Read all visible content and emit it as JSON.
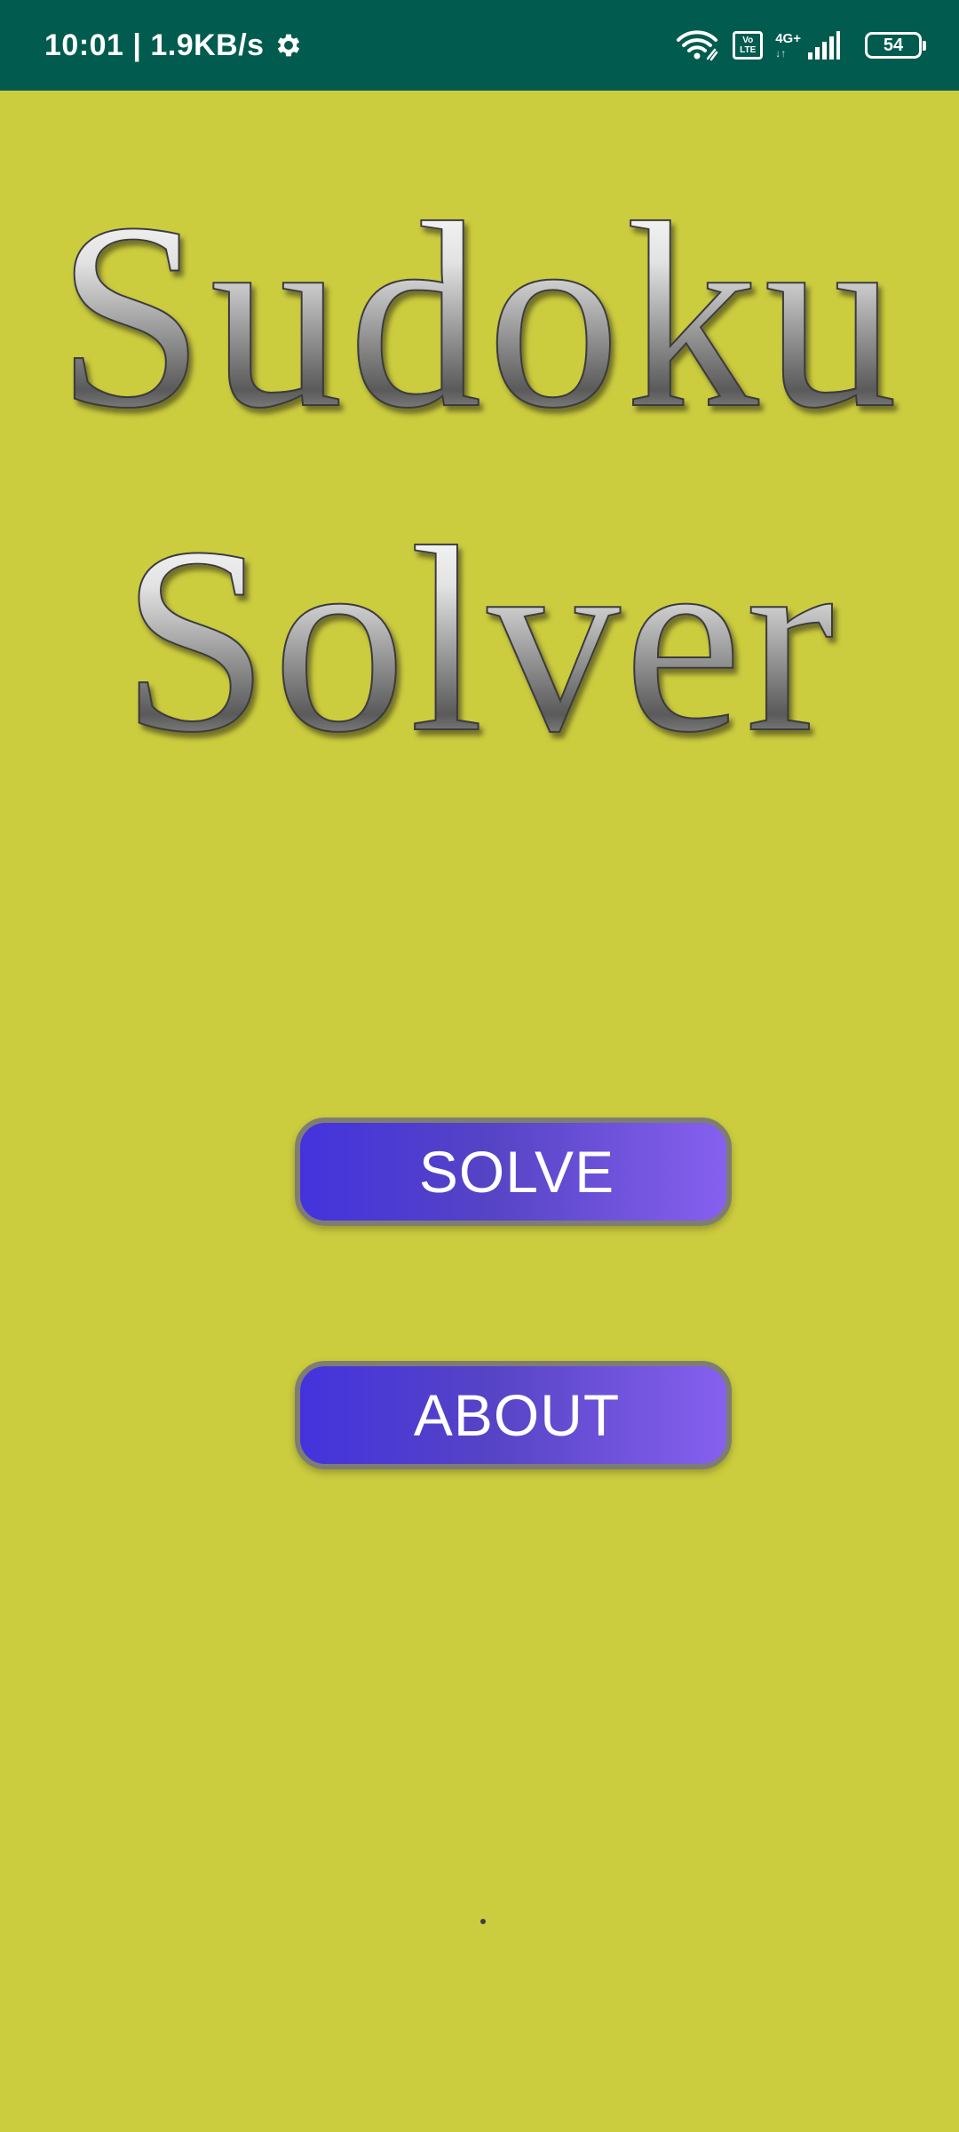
{
  "status_bar": {
    "time_speed": "10:01 | 1.9KB/s",
    "icons": [
      "gear-icon",
      "wifi-icon",
      "volte-icon",
      "signal-icon",
      "battery-icon"
    ],
    "volte_top": "Vo",
    "volte_bottom": "LTE",
    "network_type": "4G+",
    "network_arrows": "↓↑",
    "battery_level": "54",
    "background_color": "#015b4e"
  },
  "title": {
    "line1": "Sudoku",
    "line2": "Solver"
  },
  "buttons": {
    "solve_label": "SOLVE",
    "about_label": "ABOUT"
  },
  "colors": {
    "background": "#cccc3f",
    "button_gradient_start": "#4433dd",
    "button_gradient_end": "#8660ef",
    "button_border": "#7e7d74"
  }
}
